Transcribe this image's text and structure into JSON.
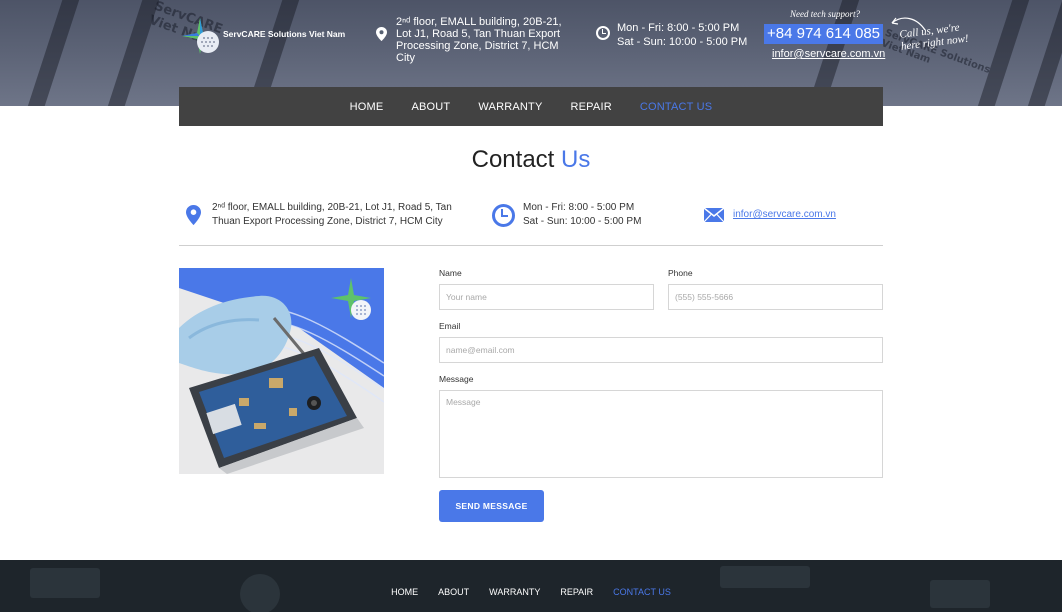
{
  "header": {
    "logo_text": "ServCARE Solutions Viet Nam",
    "address": "2ⁿᵈ floor, EMALL building, 20B-21, Lot J1, Road 5, Tan Thuan Export Processing Zone, District 7, HCM City",
    "hours_line1": "Mon - Fri: 8:00 - 5:00 PM",
    "hours_line2": "Sat - Sun: 10:00 - 5:00 PM",
    "need_support": "Need tech support?",
    "phone": "+84 974 614 085",
    "email": "infor@servcare.com.vn",
    "call_us": "Call us, we're here right now!"
  },
  "nav": {
    "items": [
      {
        "label": "HOME"
      },
      {
        "label": "ABOUT"
      },
      {
        "label": "WARRANTY"
      },
      {
        "label": "REPAIR"
      },
      {
        "label": "CONTACT US"
      }
    ],
    "active": "CONTACT US"
  },
  "contact": {
    "title_part1": "Contact",
    "title_part2": "Us",
    "address": "2ⁿᵈ floor, EMALL building, 20B-21, Lot J1, Road 5, Tan Thuan Export Processing Zone, District 7, HCM City",
    "hours_line1": "Mon - Fri: 8:00 - 5:00 PM",
    "hours_line2": "Sat - Sun: 10:00 - 5:00 PM",
    "email": "infor@servcare.com.vn"
  },
  "form": {
    "name_label": "Name",
    "name_placeholder": "Your name",
    "phone_label": "Phone",
    "phone_placeholder": "(555) 555-5666",
    "email_label": "Email",
    "email_placeholder": "name@email.com",
    "message_label": "Message",
    "message_placeholder": "Message",
    "submit_label": "SEND MESSAGE"
  },
  "footer": {
    "items": [
      {
        "label": "HOME"
      },
      {
        "label": "ABOUT"
      },
      {
        "label": "WARRANTY"
      },
      {
        "label": "REPAIR"
      },
      {
        "label": "CONTACT US"
      }
    ]
  },
  "colors": {
    "accent": "#4a78e8",
    "nav_bg": "#424242",
    "footer_bg": "#1e252b"
  },
  "icons": [
    "map-pin-icon",
    "clock-icon",
    "mail-icon",
    "arrow-icon",
    "logo-star-icon"
  ]
}
